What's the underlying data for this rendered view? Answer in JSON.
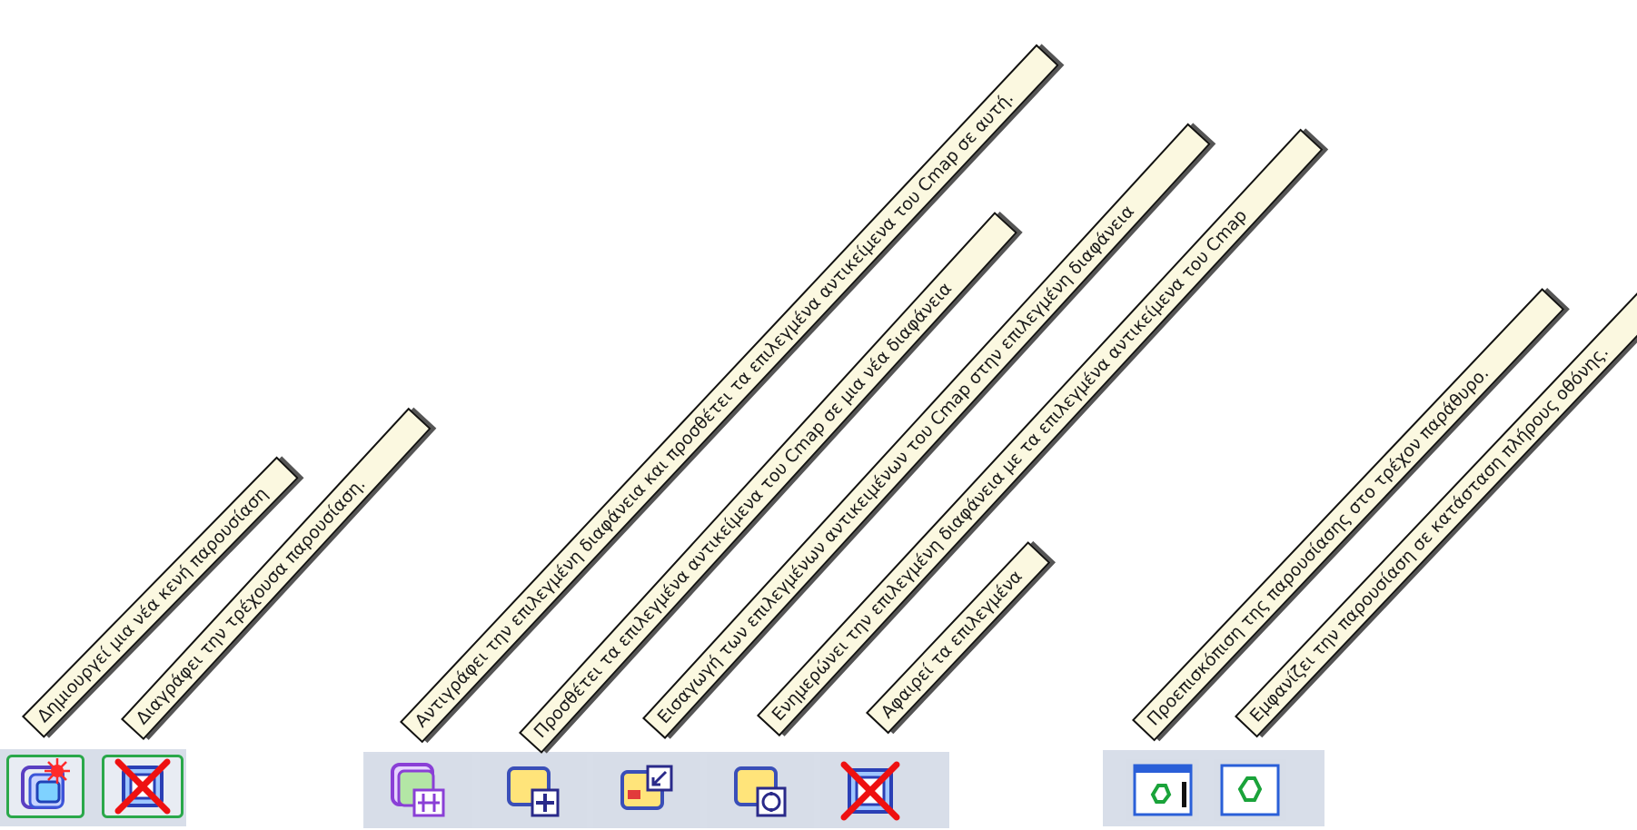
{
  "groups": [
    {
      "name": "presentation",
      "buttons": [
        {
          "icon": "new-presentation-icon",
          "tooltip": "Δημιουργεί μια νέα κενή παρουσίαση"
        },
        {
          "icon": "delete-presentation-icon",
          "tooltip": "Διαγράφει την τρέχουσα παρουσίαση."
        }
      ]
    },
    {
      "name": "slide",
      "buttons": [
        {
          "icon": "duplicate-slide-icon",
          "tooltip": "Αντιγράφει την επιλεγμένη διαφάνεια και προσθέτει τα επιλεγμένα αντικείμενα του Cmap σε αυτή."
        },
        {
          "icon": "add-to-new-slide-icon",
          "tooltip": "Προσθέτει τα επιλεγμένα αντικείμενα του Cmap σε μια νέα διαφάνεια"
        },
        {
          "icon": "import-to-slide-icon",
          "tooltip": "Εισαγωγή των επιλεγμένων αντικειμένων του Cmap στην επιλεγμένη διαφάνεια"
        },
        {
          "icon": "update-slide-icon",
          "tooltip": "Ενημερώνει την επιλεγμένη διαφάνεια με τα επιλεγμένα αντικείμενα του Cmap"
        },
        {
          "icon": "remove-selected-icon",
          "tooltip": "Αφαιρεί τα επιλεγμένα"
        }
      ]
    },
    {
      "name": "view",
      "buttons": [
        {
          "icon": "preview-window-icon",
          "tooltip": "Προεπισκόπιση της παρουσίασης στο τρέχον παράθυρο."
        },
        {
          "icon": "fullscreen-presentation-icon",
          "tooltip": "Εμφανίζει την παρουσίαση σε κατάσταση πλήρους οθόνης."
        }
      ]
    }
  ]
}
